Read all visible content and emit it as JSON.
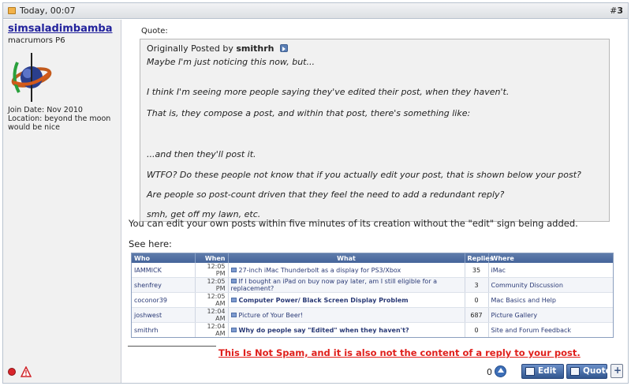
{
  "post": {
    "date": "Today, 00:07",
    "number_prefix": "#",
    "number": "3"
  },
  "user": {
    "name": "simsaladimbamba",
    "title": "macrumors P6",
    "join_date": "Join Date: Nov 2010",
    "location_line1": "Location: beyond the moon",
    "location_line2": "would be nice"
  },
  "quote": {
    "label": "Quote:",
    "originally_posted_by": "Originally Posted by",
    "author": "smithrh",
    "lines": [
      "Maybe I'm just noticing this now, but...",
      "I think I'm seeing more people saying they've edited their post, when they haven't.",
      "That is, they compose a post, and within that post, there's something like:",
      "...and then they'll post it.",
      "WTFO? Do these people not know that if you actually edit your post, that is shown below your post?",
      "Are people so post-count driven that they feel the need to add a redundant reply?",
      "smh, get off my lawn, etc."
    ]
  },
  "reply": {
    "line1": "You can edit your own posts within five minutes of its creation without the \"edit\" sign being added.",
    "line2": "See here:"
  },
  "embedded_table": {
    "headers": [
      "Who",
      "When",
      "What",
      "Replies",
      "Where"
    ],
    "rows": [
      {
        "who": "IAMMICK",
        "when": "12:05 PM",
        "what": "27-inch iMac Thunderbolt as a display for PS3/Xbox",
        "replies": "35",
        "where": "iMac",
        "bold": false
      },
      {
        "who": "shenfrey",
        "when": "12:05 PM",
        "what": "If I bought an iPad on buy now pay later, am I still eligible for a replacement?",
        "replies": "3",
        "where": "Community Discussion",
        "bold": false
      },
      {
        "who": "coconor39",
        "when": "12:05 AM",
        "what": "Computer Power/ Black Screen Display Problem",
        "replies": "0",
        "where": "Mac Basics and Help",
        "bold": true
      },
      {
        "who": "joshwest",
        "when": "12:04 AM",
        "what": "Picture of Your Beer!",
        "replies": "687",
        "where": "Picture Gallery",
        "bold": false
      },
      {
        "who": "smithrh",
        "when": "12:04 AM",
        "what": "Why do people say \"Edited\" when they haven't?",
        "replies": "0",
        "where": "Site and Forum Feedback",
        "bold": true
      }
    ]
  },
  "signature": "This Is Not Spam, and it is also not the content of a reply to your post.",
  "actions": {
    "reputation_count": "0",
    "edit_label": "Edit",
    "quote_label": "Quote"
  },
  "colors": {
    "username": "#22229c",
    "signature": "#e0201c",
    "button": "#32578f",
    "table_header": "#45649a"
  },
  "icons": {
    "post_icon": "post-icon",
    "online_status": "online-status-icon",
    "report": "report-post-icon",
    "view_post": "view-post-icon",
    "reputation": "reputation-up-icon",
    "multiquote": "multiquote-icon"
  }
}
